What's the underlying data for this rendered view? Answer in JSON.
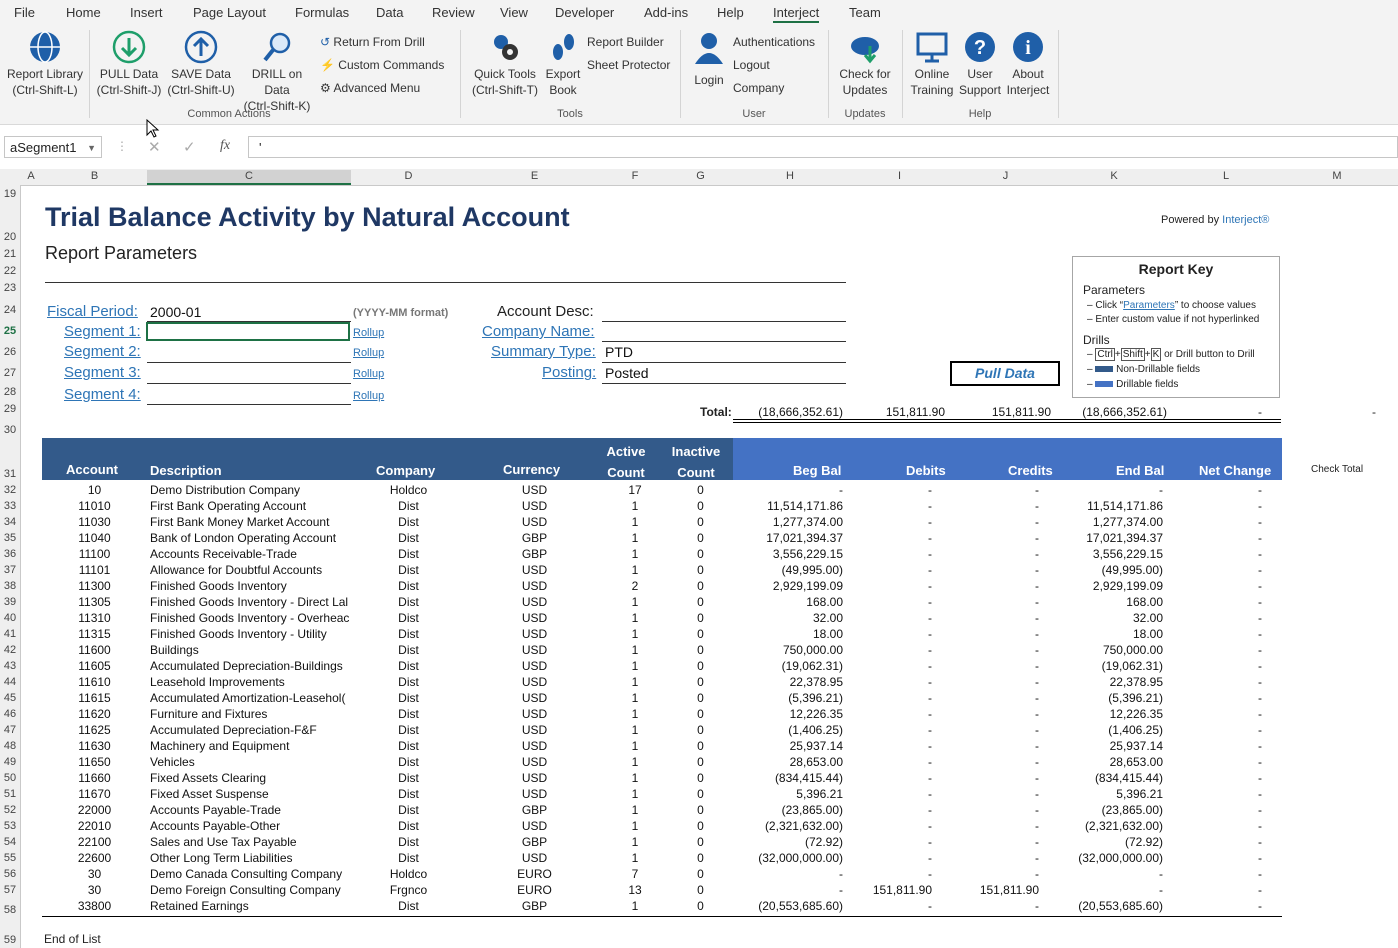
{
  "menu_tabs": [
    "File",
    "Home",
    "Insert",
    "Page Layout",
    "Formulas",
    "Data",
    "Review",
    "View",
    "Developer",
    "Add-ins",
    "Help",
    "Interject",
    "Team"
  ],
  "ribbon": {
    "report_library": [
      "Report Library",
      "(Ctrl-Shift-L)"
    ],
    "pull_data": [
      "PULL Data",
      "(Ctrl-Shift-J)"
    ],
    "save_data": [
      "SAVE Data",
      "(Ctrl-Shift-U)"
    ],
    "drill_on_data": [
      "DRILL on Data",
      "(Ctrl-Shift-K)"
    ],
    "return_from_drill": "Return From Drill",
    "custom_commands": "Custom Commands",
    "advanced_menu": "Advanced Menu",
    "common_actions": "Common Actions",
    "quick_tools": [
      "Quick Tools",
      "(Ctrl-Shift-T)"
    ],
    "export_book": [
      "Export",
      "Book"
    ],
    "report_builder": "Report Builder",
    "sheet_protector": "Sheet Protector",
    "tools": "Tools",
    "login": "Login",
    "authentications": "Authentications",
    "logout": "Logout",
    "company": "Company",
    "user": "User",
    "check_updates": [
      "Check for",
      "Updates"
    ],
    "updates": "Updates",
    "online_training": [
      "Online",
      "Training"
    ],
    "user_support": [
      "User",
      "Support"
    ],
    "about": [
      "About",
      "Interject"
    ],
    "help": "Help"
  },
  "formula_bar": {
    "name_box": "aSegment1",
    "formula": "'"
  },
  "columns": [
    "A",
    "B",
    "C",
    "D",
    "E",
    "F",
    "G",
    "H",
    "I",
    "J",
    "K",
    "L",
    "M"
  ],
  "row_numbers": [
    "19",
    "20",
    "21",
    "22",
    "23",
    "24",
    "25",
    "26",
    "27",
    "28",
    "29",
    "30",
    "31",
    "32",
    "33",
    "34",
    "35",
    "36",
    "37",
    "38",
    "39",
    "40",
    "41",
    "42",
    "43",
    "44",
    "45",
    "46",
    "47",
    "48",
    "49",
    "50",
    "51",
    "52",
    "53",
    "54",
    "55",
    "56",
    "57",
    "58",
    "59"
  ],
  "report": {
    "title": "Trial Balance Activity by Natural Account",
    "subtitle": "Report Parameters",
    "powered_prefix": "Powered by ",
    "powered_brand": "Interject®",
    "fiscal_period_label": "Fiscal Period:",
    "fiscal_period_value": "2000-01",
    "fiscal_hint": "(YYYY-MM format)",
    "segment1": "Segment 1:",
    "segment2": "Segment 2:",
    "segment3": "Segment 3:",
    "segment4": "Segment 4:",
    "rollup": "Rollup",
    "account_desc_label": "Account Desc:",
    "company_name_label": "Company Name:",
    "summary_type_label": "Summary Type:",
    "summary_type_value": "PTD",
    "posting_label": "Posting:",
    "posting_value": "Posted",
    "pull_data_button": "Pull Data",
    "total_label": "Total:",
    "totals": [
      "(18,666,352.61)",
      "151,811.90",
      "151,811.90",
      "(18,666,352.61)",
      "-"
    ],
    "total_tail": "-",
    "end_of_list": "End of List"
  },
  "report_key": {
    "title": "Report Key",
    "parameters": "Parameters",
    "click_pre": "Click “",
    "click_link": "Parameters",
    "click_post": "” to choose values",
    "enter_custom": "Enter custom value if not hyperlinked",
    "drills": "Drills",
    "ctrl": "Ctrl",
    "shift": "Shift",
    "k": "K",
    "drill_instr": "or Drill button to Drill",
    "non_drillable": "Non-Drillable fields",
    "drillable": "Drillable fields",
    "non_drillable_color": "#335a8a",
    "drillable_color": "#4472c4"
  },
  "table_headers": {
    "account": "Account",
    "description": "Description",
    "company": "Company",
    "currency": "Currency",
    "active": [
      "Active",
      "Count"
    ],
    "inactive": [
      "Inactive",
      "Count"
    ],
    "beg_bal": "Beg Bal",
    "debits": "Debits",
    "credits": "Credits",
    "end_bal": "End Bal",
    "net_change": "Net Change",
    "check_total": "Check Total"
  },
  "rows": [
    [
      "10",
      "Demo Distribution Company",
      "Holdco",
      "USD",
      "17",
      "0",
      "-",
      "-",
      "-",
      "-",
      "-"
    ],
    [
      "11010",
      "First Bank Operating Account",
      "Dist",
      "USD",
      "1",
      "0",
      "11,514,171.86",
      "-",
      "-",
      "11,514,171.86",
      "-"
    ],
    [
      "11030",
      "First Bank Money Market Account",
      "Dist",
      "USD",
      "1",
      "0",
      "1,277,374.00",
      "-",
      "-",
      "1,277,374.00",
      "-"
    ],
    [
      "11040",
      "Bank of London Operating Account",
      "Dist",
      "GBP",
      "1",
      "0",
      "17,021,394.37",
      "-",
      "-",
      "17,021,394.37",
      "-"
    ],
    [
      "11100",
      "Accounts Receivable-Trade",
      "Dist",
      "GBP",
      "1",
      "0",
      "3,556,229.15",
      "-",
      "-",
      "3,556,229.15",
      "-"
    ],
    [
      "11101",
      "Allowance for Doubtful Accounts",
      "Dist",
      "USD",
      "1",
      "0",
      "(49,995.00)",
      "-",
      "-",
      "(49,995.00)",
      "-"
    ],
    [
      "11300",
      "Finished Goods Inventory",
      "Dist",
      "USD",
      "2",
      "0",
      "2,929,199.09",
      "-",
      "-",
      "2,929,199.09",
      "-"
    ],
    [
      "11305",
      "Finished Goods Inventory - Direct Lal",
      "Dist",
      "USD",
      "1",
      "0",
      "168.00",
      "-",
      "-",
      "168.00",
      "-"
    ],
    [
      "11310",
      "Finished Goods Inventory - Overheac",
      "Dist",
      "USD",
      "1",
      "0",
      "32.00",
      "-",
      "-",
      "32.00",
      "-"
    ],
    [
      "11315",
      "Finished Goods Inventory - Utility",
      "Dist",
      "USD",
      "1",
      "0",
      "18.00",
      "-",
      "-",
      "18.00",
      "-"
    ],
    [
      "11600",
      "Buildings",
      "Dist",
      "USD",
      "1",
      "0",
      "750,000.00",
      "-",
      "-",
      "750,000.00",
      "-"
    ],
    [
      "11605",
      "Accumulated Depreciation-Buildings",
      "Dist",
      "USD",
      "1",
      "0",
      "(19,062.31)",
      "-",
      "-",
      "(19,062.31)",
      "-"
    ],
    [
      "11610",
      "Leasehold Improvements",
      "Dist",
      "USD",
      "1",
      "0",
      "22,378.95",
      "-",
      "-",
      "22,378.95",
      "-"
    ],
    [
      "11615",
      "Accumulated Amortization-Leasehol(",
      "Dist",
      "USD",
      "1",
      "0",
      "(5,396.21)",
      "-",
      "-",
      "(5,396.21)",
      "-"
    ],
    [
      "11620",
      "Furniture and Fixtures",
      "Dist",
      "USD",
      "1",
      "0",
      "12,226.35",
      "-",
      "-",
      "12,226.35",
      "-"
    ],
    [
      "11625",
      "Accumulated Depreciation-F&F",
      "Dist",
      "USD",
      "1",
      "0",
      "(1,406.25)",
      "-",
      "-",
      "(1,406.25)",
      "-"
    ],
    [
      "11630",
      "Machinery and Equipment",
      "Dist",
      "USD",
      "1",
      "0",
      "25,937.14",
      "-",
      "-",
      "25,937.14",
      "-"
    ],
    [
      "11650",
      "Vehicles",
      "Dist",
      "USD",
      "1",
      "0",
      "28,653.00",
      "-",
      "-",
      "28,653.00",
      "-"
    ],
    [
      "11660",
      "Fixed Assets Clearing",
      "Dist",
      "USD",
      "1",
      "0",
      "(834,415.44)",
      "-",
      "-",
      "(834,415.44)",
      "-"
    ],
    [
      "11670",
      "Fixed Asset Suspense",
      "Dist",
      "USD",
      "1",
      "0",
      "5,396.21",
      "-",
      "-",
      "5,396.21",
      "-"
    ],
    [
      "22000",
      "Accounts Payable-Trade",
      "Dist",
      "GBP",
      "1",
      "0",
      "(23,865.00)",
      "-",
      "-",
      "(23,865.00)",
      "-"
    ],
    [
      "22010",
      "Accounts Payable-Other",
      "Dist",
      "USD",
      "1",
      "0",
      "(2,321,632.00)",
      "-",
      "-",
      "(2,321,632.00)",
      "-"
    ],
    [
      "22100",
      "Sales and Use Tax Payable",
      "Dist",
      "GBP",
      "1",
      "0",
      "(72.92)",
      "-",
      "-",
      "(72.92)",
      "-"
    ],
    [
      "22600",
      "Other Long Term Liabilities",
      "Dist",
      "USD",
      "1",
      "0",
      "(32,000,000.00)",
      "-",
      "-",
      "(32,000,000.00)",
      "-"
    ],
    [
      "30",
      "Demo Canada Consulting Company",
      "Holdco",
      "EURO",
      "7",
      "0",
      "-",
      "-",
      "-",
      "-",
      "-"
    ],
    [
      "30",
      "Demo Foreign Consulting Company",
      "Frgnco",
      "EURO",
      "13",
      "0",
      "-",
      "151,811.90",
      "151,811.90",
      "-",
      "-"
    ],
    [
      "33800",
      "Retained Earnings",
      "Dist",
      "GBP",
      "1",
      "0",
      "(20,553,685.60)",
      "-",
      "-",
      "(20,553,685.60)",
      "-"
    ]
  ]
}
